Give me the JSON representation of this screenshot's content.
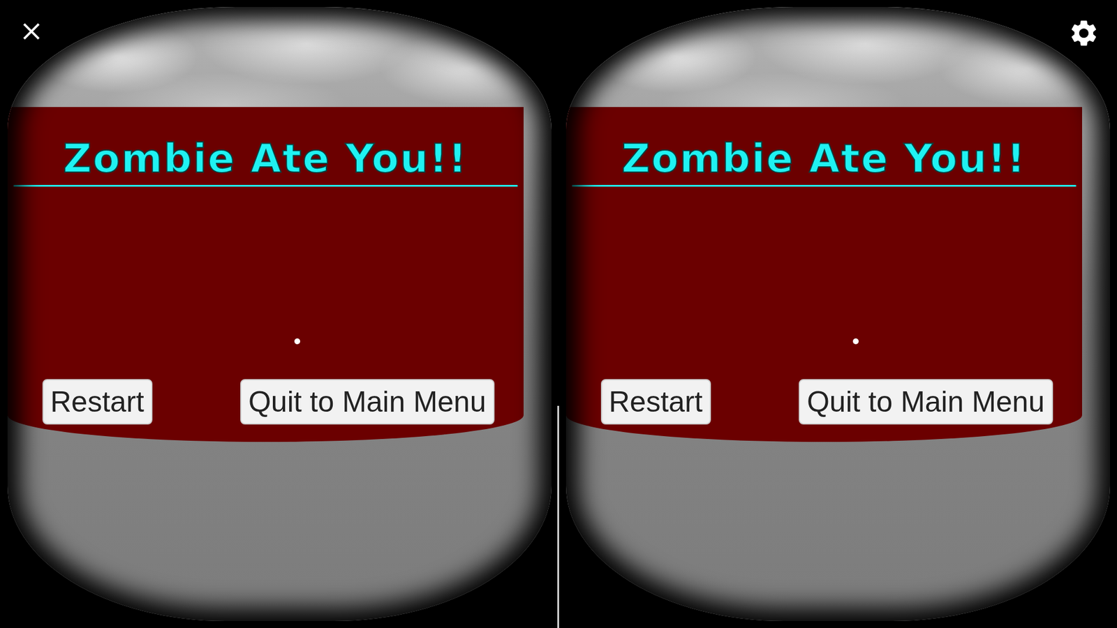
{
  "eyes": [
    {
      "side": "left",
      "title": "Zombie Ate You!!",
      "buttons": [
        {
          "label": "Restart"
        },
        {
          "label": "Quit to Main Menu"
        }
      ]
    },
    {
      "side": "right",
      "title": "Zombie Ate You!!",
      "buttons": [
        {
          "label": "Restart"
        },
        {
          "label": "Quit to Main Menu"
        }
      ]
    }
  ]
}
